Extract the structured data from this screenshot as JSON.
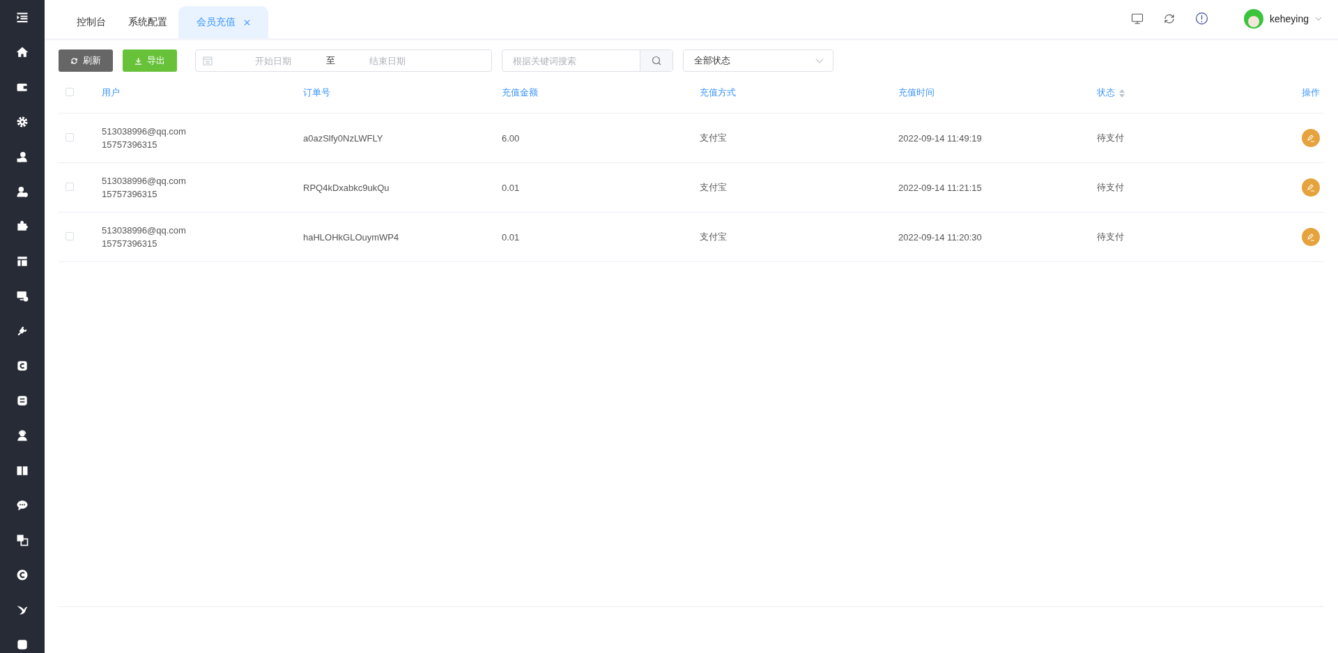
{
  "tabs": [
    {
      "label": "控制台",
      "selected": false,
      "closable": false
    },
    {
      "label": "系统配置",
      "selected": false,
      "closable": false
    },
    {
      "label": "会员充值",
      "selected": true,
      "closable": true
    }
  ],
  "user": {
    "name": "keheying"
  },
  "toolbar": {
    "buttons": [
      {
        "label": "刷新",
        "kind": "refresh"
      },
      {
        "label": "导出",
        "kind": "export"
      }
    ],
    "date_range": {
      "start_placeholder": "开始日期",
      "separator": "至",
      "end_placeholder": "结束日期"
    },
    "search": {
      "placeholder": "根据关键词搜索"
    },
    "status_select": {
      "value": "全部状态"
    }
  },
  "table": {
    "all_checked": false,
    "columns": [
      {
        "label": "用户",
        "sortable": false
      },
      {
        "label": "订单号",
        "sortable": false
      },
      {
        "label": "充值金额",
        "sortable": false
      },
      {
        "label": "充值方式",
        "sortable": false
      },
      {
        "label": "充值时间",
        "sortable": false
      },
      {
        "label": "状态",
        "sortable": true
      },
      {
        "label": "操作",
        "sortable": false
      }
    ],
    "rows": [
      {
        "checked": false,
        "email": "513038996@qq.com",
        "phone": "15757396315",
        "order": "a0azSlfy0NzLWFLY",
        "amount": "6.00",
        "method": "支付宝",
        "time": "2022-09-14 11:49:19",
        "status": "待支付"
      },
      {
        "checked": false,
        "email": "513038996@qq.com",
        "phone": "15757396315",
        "order": "RPQ4kDxabkc9ukQu",
        "amount": "0.01",
        "method": "支付宝",
        "time": "2022-09-14 11:21:15",
        "status": "待支付"
      },
      {
        "checked": false,
        "email": "513038996@qq.com",
        "phone": "15757396315",
        "order": "haHLOHkGLOuymWP4",
        "amount": "0.01",
        "method": "支付宝",
        "time": "2022-09-14 11:20:30",
        "status": "待支付"
      }
    ]
  }
}
